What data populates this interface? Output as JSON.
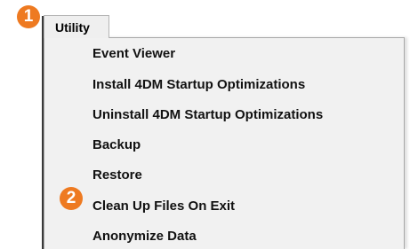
{
  "menu": {
    "title": "Utility",
    "items": [
      {
        "label": "Event Viewer"
      },
      {
        "label": "Install 4DM Startup Optimizations"
      },
      {
        "label": "Uninstall 4DM Startup Optimizations"
      },
      {
        "label": "Backup"
      },
      {
        "label": "Restore"
      },
      {
        "label": "Clean Up Files On Exit"
      },
      {
        "label": "Anonymize Data"
      }
    ]
  },
  "callouts": [
    {
      "number": "1"
    },
    {
      "number": "2"
    }
  ],
  "colors": {
    "callout": "#ee7a21",
    "menu_background": "#f1f1f1"
  }
}
